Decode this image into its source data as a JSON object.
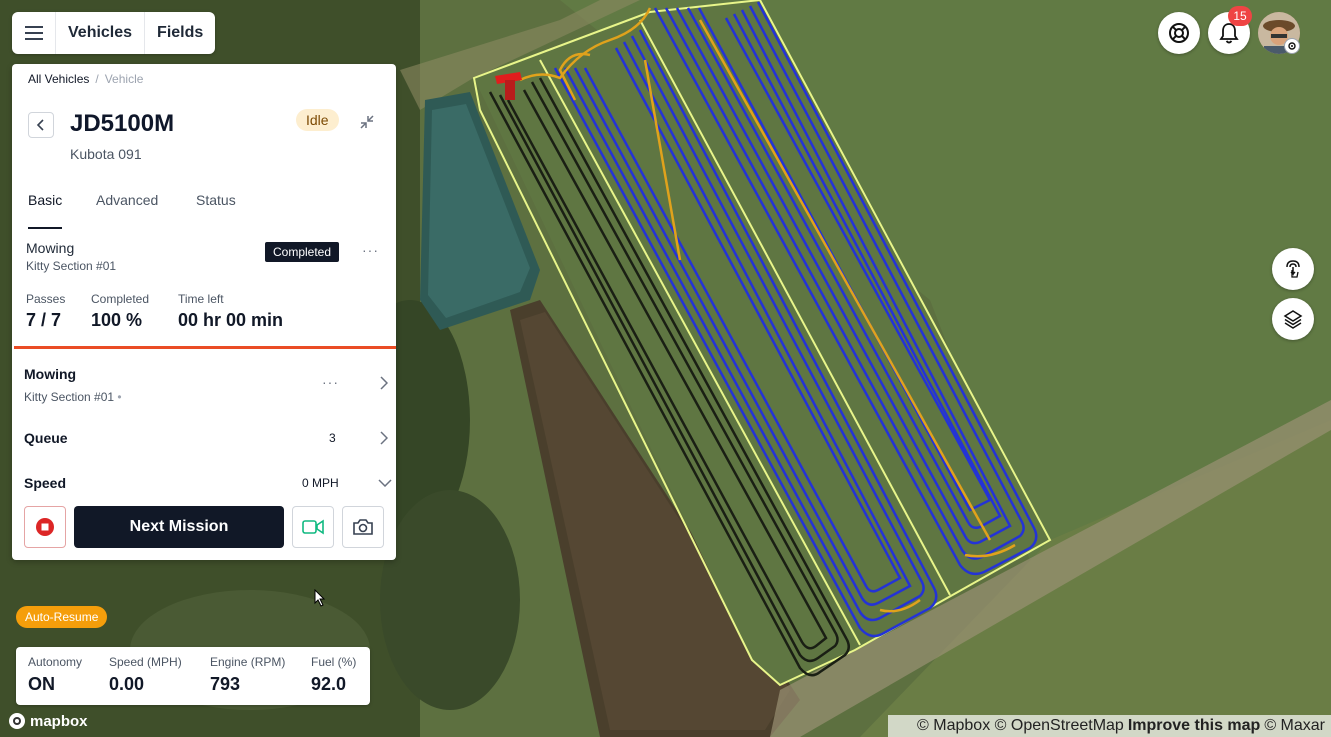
{
  "nav": {
    "vehicles_label": "Vehicles",
    "fields_label": "Fields"
  },
  "notifications": {
    "count": "15"
  },
  "breadcrumb": {
    "all": "All Vehicles",
    "current": "Vehicle"
  },
  "vehicle": {
    "name": "JD5100M",
    "subtitle": "Kubota 091",
    "state": "Idle"
  },
  "tabs": [
    "Basic",
    "Advanced",
    "Status"
  ],
  "mission": {
    "title": "Mowing",
    "field": "Kitty Section #01",
    "status": "Completed",
    "stats": [
      {
        "label": "Passes",
        "value": "7 / 7"
      },
      {
        "label": "Completed",
        "value": "100 %"
      },
      {
        "label": "Time left",
        "value": "00 hr 00 min"
      }
    ]
  },
  "rows": {
    "current_title": "Mowing",
    "current_sub": "Kitty Section #01",
    "queue_label": "Queue",
    "queue_count": "3",
    "speed_label": "Speed",
    "speed_value": "0 MPH"
  },
  "actions": {
    "next_mission": "Next Mission"
  },
  "auto_resume": "Auto-Resume",
  "telemetry": [
    {
      "label": "Autonomy",
      "value": "ON"
    },
    {
      "label": "Speed (MPH)",
      "value": "0.00"
    },
    {
      "label": "Engine (RPM)",
      "value": "793"
    },
    {
      "label": "Fuel (%)",
      "value": "92.0"
    }
  ],
  "map": {
    "logo": "mapbox",
    "attribution": {
      "mapbox": "© Mapbox",
      "osm": "© OpenStreetMap",
      "improve": "Improve this map",
      "maxar": "© Maxar"
    },
    "colors": {
      "boundary": "#e8f58a",
      "pass_blue": "#2433d6",
      "pass_dark": "#1a1f14",
      "path_orange": "#e0a21c",
      "vehicle_red": "#e11d1d"
    }
  }
}
